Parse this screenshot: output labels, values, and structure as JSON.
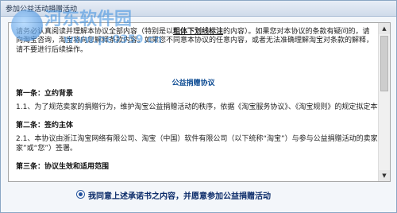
{
  "window": {
    "title": "参加公益活动捐赠活动"
  },
  "watermark": {
    "main": "河东软件园",
    "url": "www.pc0359.cn"
  },
  "agreement": {
    "intro_line1_a": "请务必认真阅读并理解本协议全部内容（特别是以",
    "intro_line1_bold": "粗体下划线标注",
    "intro_line1_b": "的内容）。如果您对本协议的条款有疑问的，请",
    "intro_line2": "向淘宝咨询，淘宝将向您解释条款内容。如果您不同意本协议的任意内容，或者无法准确理解淘宝对条款的解释，",
    "intro_line3": "请不要进行后续操作。",
    "doc_title": "公益捐赠协议",
    "article1_heading": "第一条：立约背景",
    "article1_text": "1.1、为了规范卖家的捐赠行为，维护淘宝公益捐赠活动的秩序，依据《淘宝服务协议》、《淘宝规则》的规定拟定本协议。",
    "article2_heading": "第二条：签约主体",
    "article2_text_line1": "2.1、本协议由浙江淘宝网络有限公司、淘宝（中国）软件有限公司（以下统称“淘宝”）与参与公益捐赠活动的卖家（以下简称“卖",
    "article2_text_line2": "家”或“您”）签署。",
    "article3_heading": "第三条：协议生效和适用范围"
  },
  "consent": {
    "label": "我同意上述承诺书之内容，并愿意参加公益捐赠活动",
    "checked": true
  }
}
